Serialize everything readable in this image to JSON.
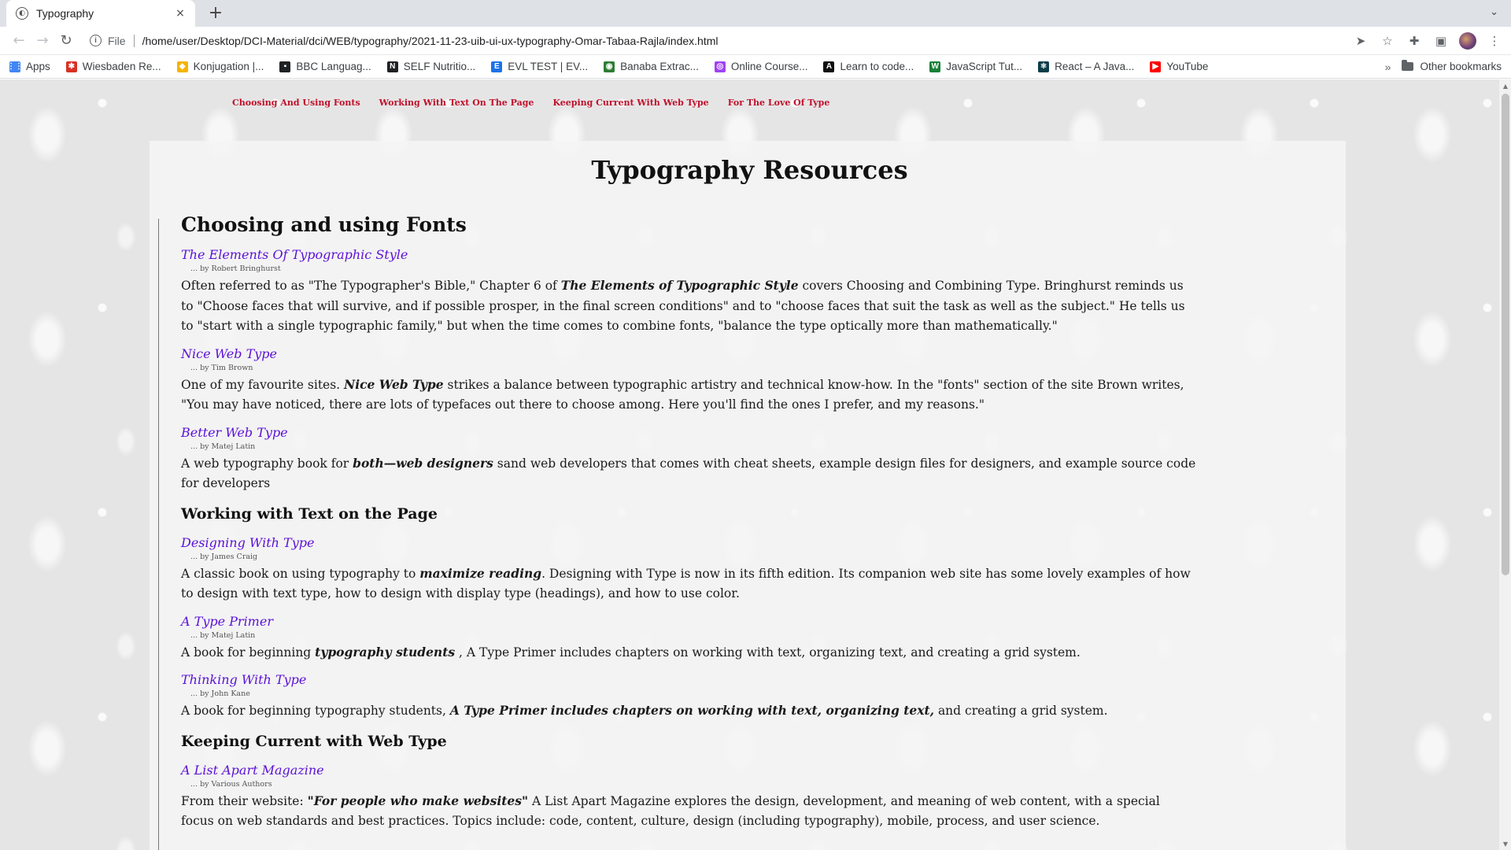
{
  "browser": {
    "tab_title": "Typography",
    "new_tab": "+",
    "close": "×",
    "tab_search": "⌄",
    "scheme": "File",
    "url": "/home/user/Desktop/DCI-Material/dci/WEB/typography/2021-11-23-uib-ui-ux-typography-Omar-Tabaa-Rajla/index.html"
  },
  "bookmarks": {
    "items": [
      {
        "label": "Apps",
        "color": "#4285f4",
        "glyph": "⋮⋮"
      },
      {
        "label": "Wiesbaden Re...",
        "color": "#d93025",
        "glyph": "✱"
      },
      {
        "label": "Konjugation |...",
        "color": "#f4b400",
        "glyph": "◆"
      },
      {
        "label": "BBC Languag...",
        "color": "#202124",
        "glyph": "▪"
      },
      {
        "label": "SELF Nutritio...",
        "color": "#202124",
        "glyph": "N"
      },
      {
        "label": "EVL TEST | EV...",
        "color": "#1a73e8",
        "glyph": "E"
      },
      {
        "label": "Banaba Extrac...",
        "color": "#2e7d32",
        "glyph": "◉"
      },
      {
        "label": "Online Course...",
        "color": "#a142f4",
        "glyph": "◎"
      },
      {
        "label": "Learn to code...",
        "color": "#111111",
        "glyph": "A"
      },
      {
        "label": "JavaScript Tut...",
        "color": "#188038",
        "glyph": "W"
      },
      {
        "label": "React – A Java...",
        "color": "#0b3d49",
        "glyph": "⚛"
      },
      {
        "label": "YouTube",
        "color": "#ff0000",
        "glyph": "▶"
      }
    ],
    "more": "»",
    "other": "Other bookmarks"
  },
  "nav": {
    "links": [
      "Choosing And Using Fonts",
      "Working With Text On The Page",
      "Keeping Current With Web Type",
      "For The Love Of Type"
    ]
  },
  "page": {
    "title": "Typography Resources"
  },
  "sections": {
    "s1": {
      "heading": "Choosing and using Fonts",
      "r1": {
        "title": "The Elements Of Typographic Style",
        "author": "... by Robert Bringhurst",
        "d1": "Often referred to as \"The Typographer's Bible,\" Chapter 6 of ",
        "d2": "The Elements of Typographic Style",
        "d3": " covers Choosing and Combining Type. Bringhurst reminds us to \"Choose faces that will survive, and if possible prosper, in the final screen conditions\" and to \"choose faces that suit the task as well as the subject.\" He tells us to \"start with a single typographic family,\" but when the time comes to combine fonts, \"balance the type optically more than mathematically.\""
      },
      "r2": {
        "title": "Nice Web Type",
        "author": "... by Tim Brown",
        "d1": "One of my favourite sites. ",
        "d2": "Nice Web Type",
        "d3": " strikes a balance between typographic artistry and technical know-how. In the \"fonts\" section of the site Brown writes, \"You may have noticed, there are lots of typefaces out there to choose among. Here you'll find the ones I prefer, and my reasons.\""
      },
      "r3": {
        "title": "Better Web Type",
        "author": "... by Matej Latin",
        "d1": "A web typography book for ",
        "d2": "both—web designers",
        "d3": " sand web developers that comes with cheat sheets, example design files for designers, and example source code for developers"
      }
    },
    "s2": {
      "heading": "Working with Text on the Page",
      "r1": {
        "title": "Designing With Type",
        "author": "... by James Craig",
        "d1": "A classic book on using typography to ",
        "d2": "maximize reading",
        "d3": ". Designing with Type is now in its fifth edition. Its companion web site has some lovely examples of how to design with text type, how to design with display type (headings), and how to use color."
      },
      "r2": {
        "title": "A Type Primer",
        "author": "... by Matej Latin",
        "d1": "A book for beginning ",
        "d2": "typography students",
        "d3": " , A Type Primer includes chapters on working with text, organizing text, and creating a grid system."
      },
      "r3": {
        "title": "Thinking With Type",
        "author": "... by John Kane",
        "d1": "A book for beginning typography students, ",
        "d2": "A Type Primer includes chapters on working with text, organizing text,",
        "d3": " and creating a grid system."
      }
    },
    "s3": {
      "heading": "Keeping Current with Web Type",
      "r1": {
        "title": "A List Apart Magazine",
        "author": "... by Various Authors",
        "d1": "From their website: ",
        "d2": "\"For people who make websites\"",
        "d3": " A List Apart Magazine explores the design, development, and meaning of web content, with a special focus on web standards and best practices. Topics include: code, content, culture, design (including typography), mobile, process, and user science."
      }
    }
  }
}
